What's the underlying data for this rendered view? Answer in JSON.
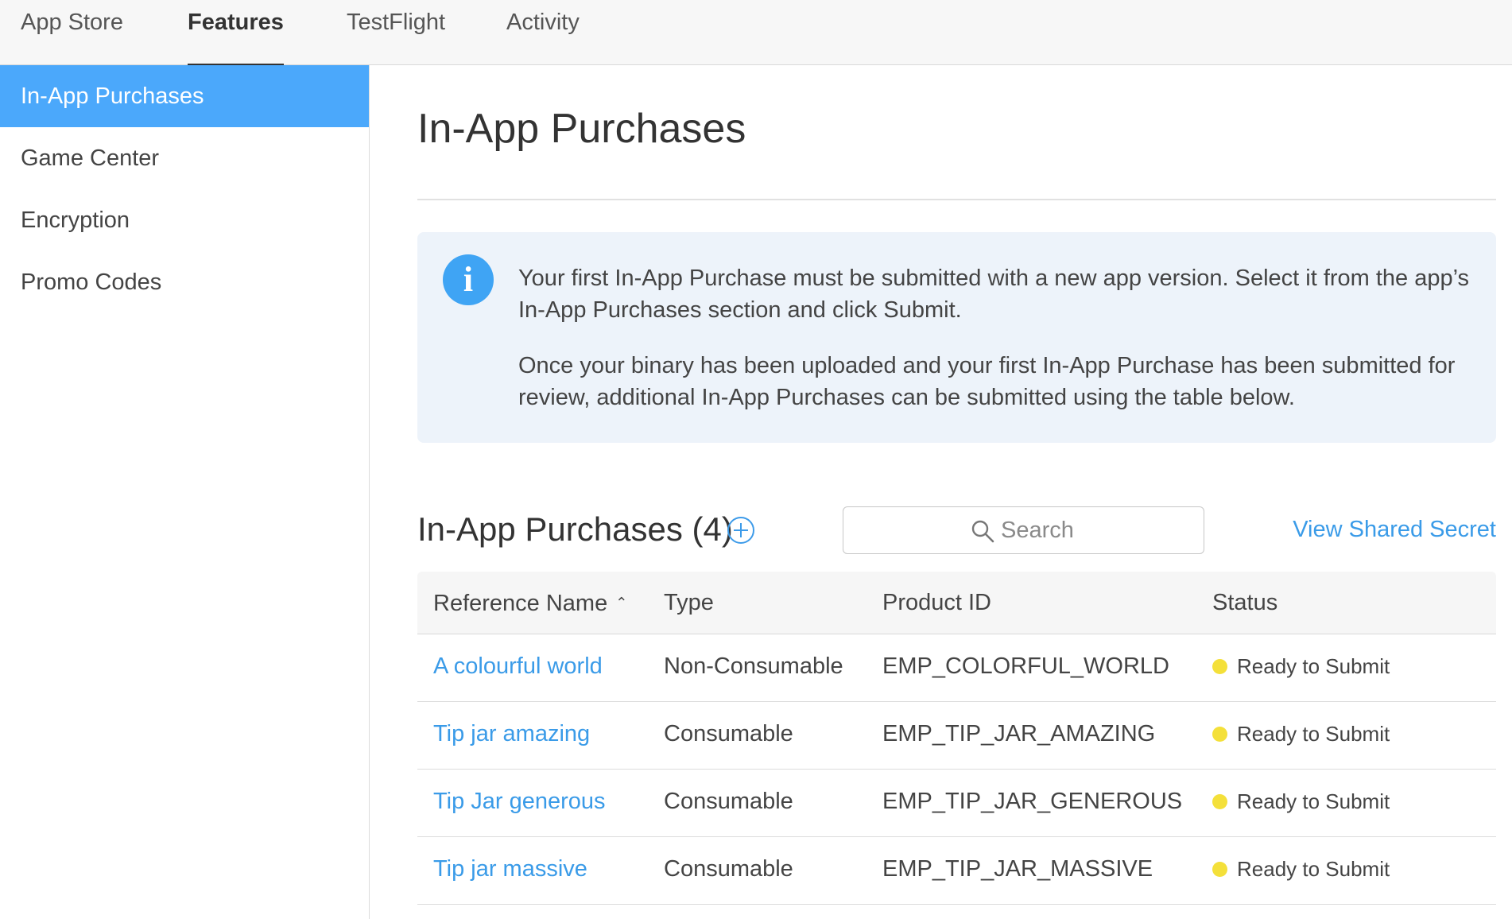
{
  "topnav": {
    "tabs": [
      {
        "label": "App Store"
      },
      {
        "label": "Features",
        "active": true
      },
      {
        "label": "TestFlight"
      },
      {
        "label": "Activity"
      }
    ]
  },
  "sidebar": {
    "items": [
      {
        "label": "In-App Purchases",
        "active": true
      },
      {
        "label": "Game Center"
      },
      {
        "label": "Encryption"
      },
      {
        "label": "Promo Codes"
      }
    ]
  },
  "main": {
    "title": "In-App Purchases",
    "info": {
      "icon": "info-icon",
      "icon_glyph": "i",
      "paragraph1": "Your first In-App Purchase must be submitted with a new app version. Select it from the app’s In-App Purchases section and click Submit.",
      "paragraph2": "Once your binary has been uploaded and your first In-App Purchase has been submitted for review, additional In-App Purchases can be submitted using the table below."
    },
    "section_title": "In-App Purchases (4)",
    "search": {
      "placeholder": "Search",
      "value": ""
    },
    "shared_secret_link": "View Shared Secret",
    "table": {
      "columns": [
        "Reference Name",
        "Type",
        "Product ID",
        "Status"
      ],
      "sort_indicator": "⌃",
      "rows": [
        {
          "name": "A colourful world",
          "type": "Non-Consumable",
          "product_id": "EMP_COLORFUL_WORLD",
          "status": "Ready to Submit"
        },
        {
          "name": "Tip jar amazing",
          "type": "Consumable",
          "product_id": "EMP_TIP_JAR_AMAZING",
          "status": "Ready to Submit"
        },
        {
          "name": "Tip Jar generous",
          "type": "Consumable",
          "product_id": "EMP_TIP_JAR_GENEROUS",
          "status": "Ready to Submit"
        },
        {
          "name": "Tip jar massive",
          "type": "Consumable",
          "product_id": "EMP_TIP_JAR_MASSIVE",
          "status": "Ready to Submit"
        }
      ]
    }
  },
  "colors": {
    "accent": "#4ba8fb",
    "link": "#3a9be8",
    "status_ready": "#f4e03a",
    "info_bg": "#edf3fa"
  }
}
